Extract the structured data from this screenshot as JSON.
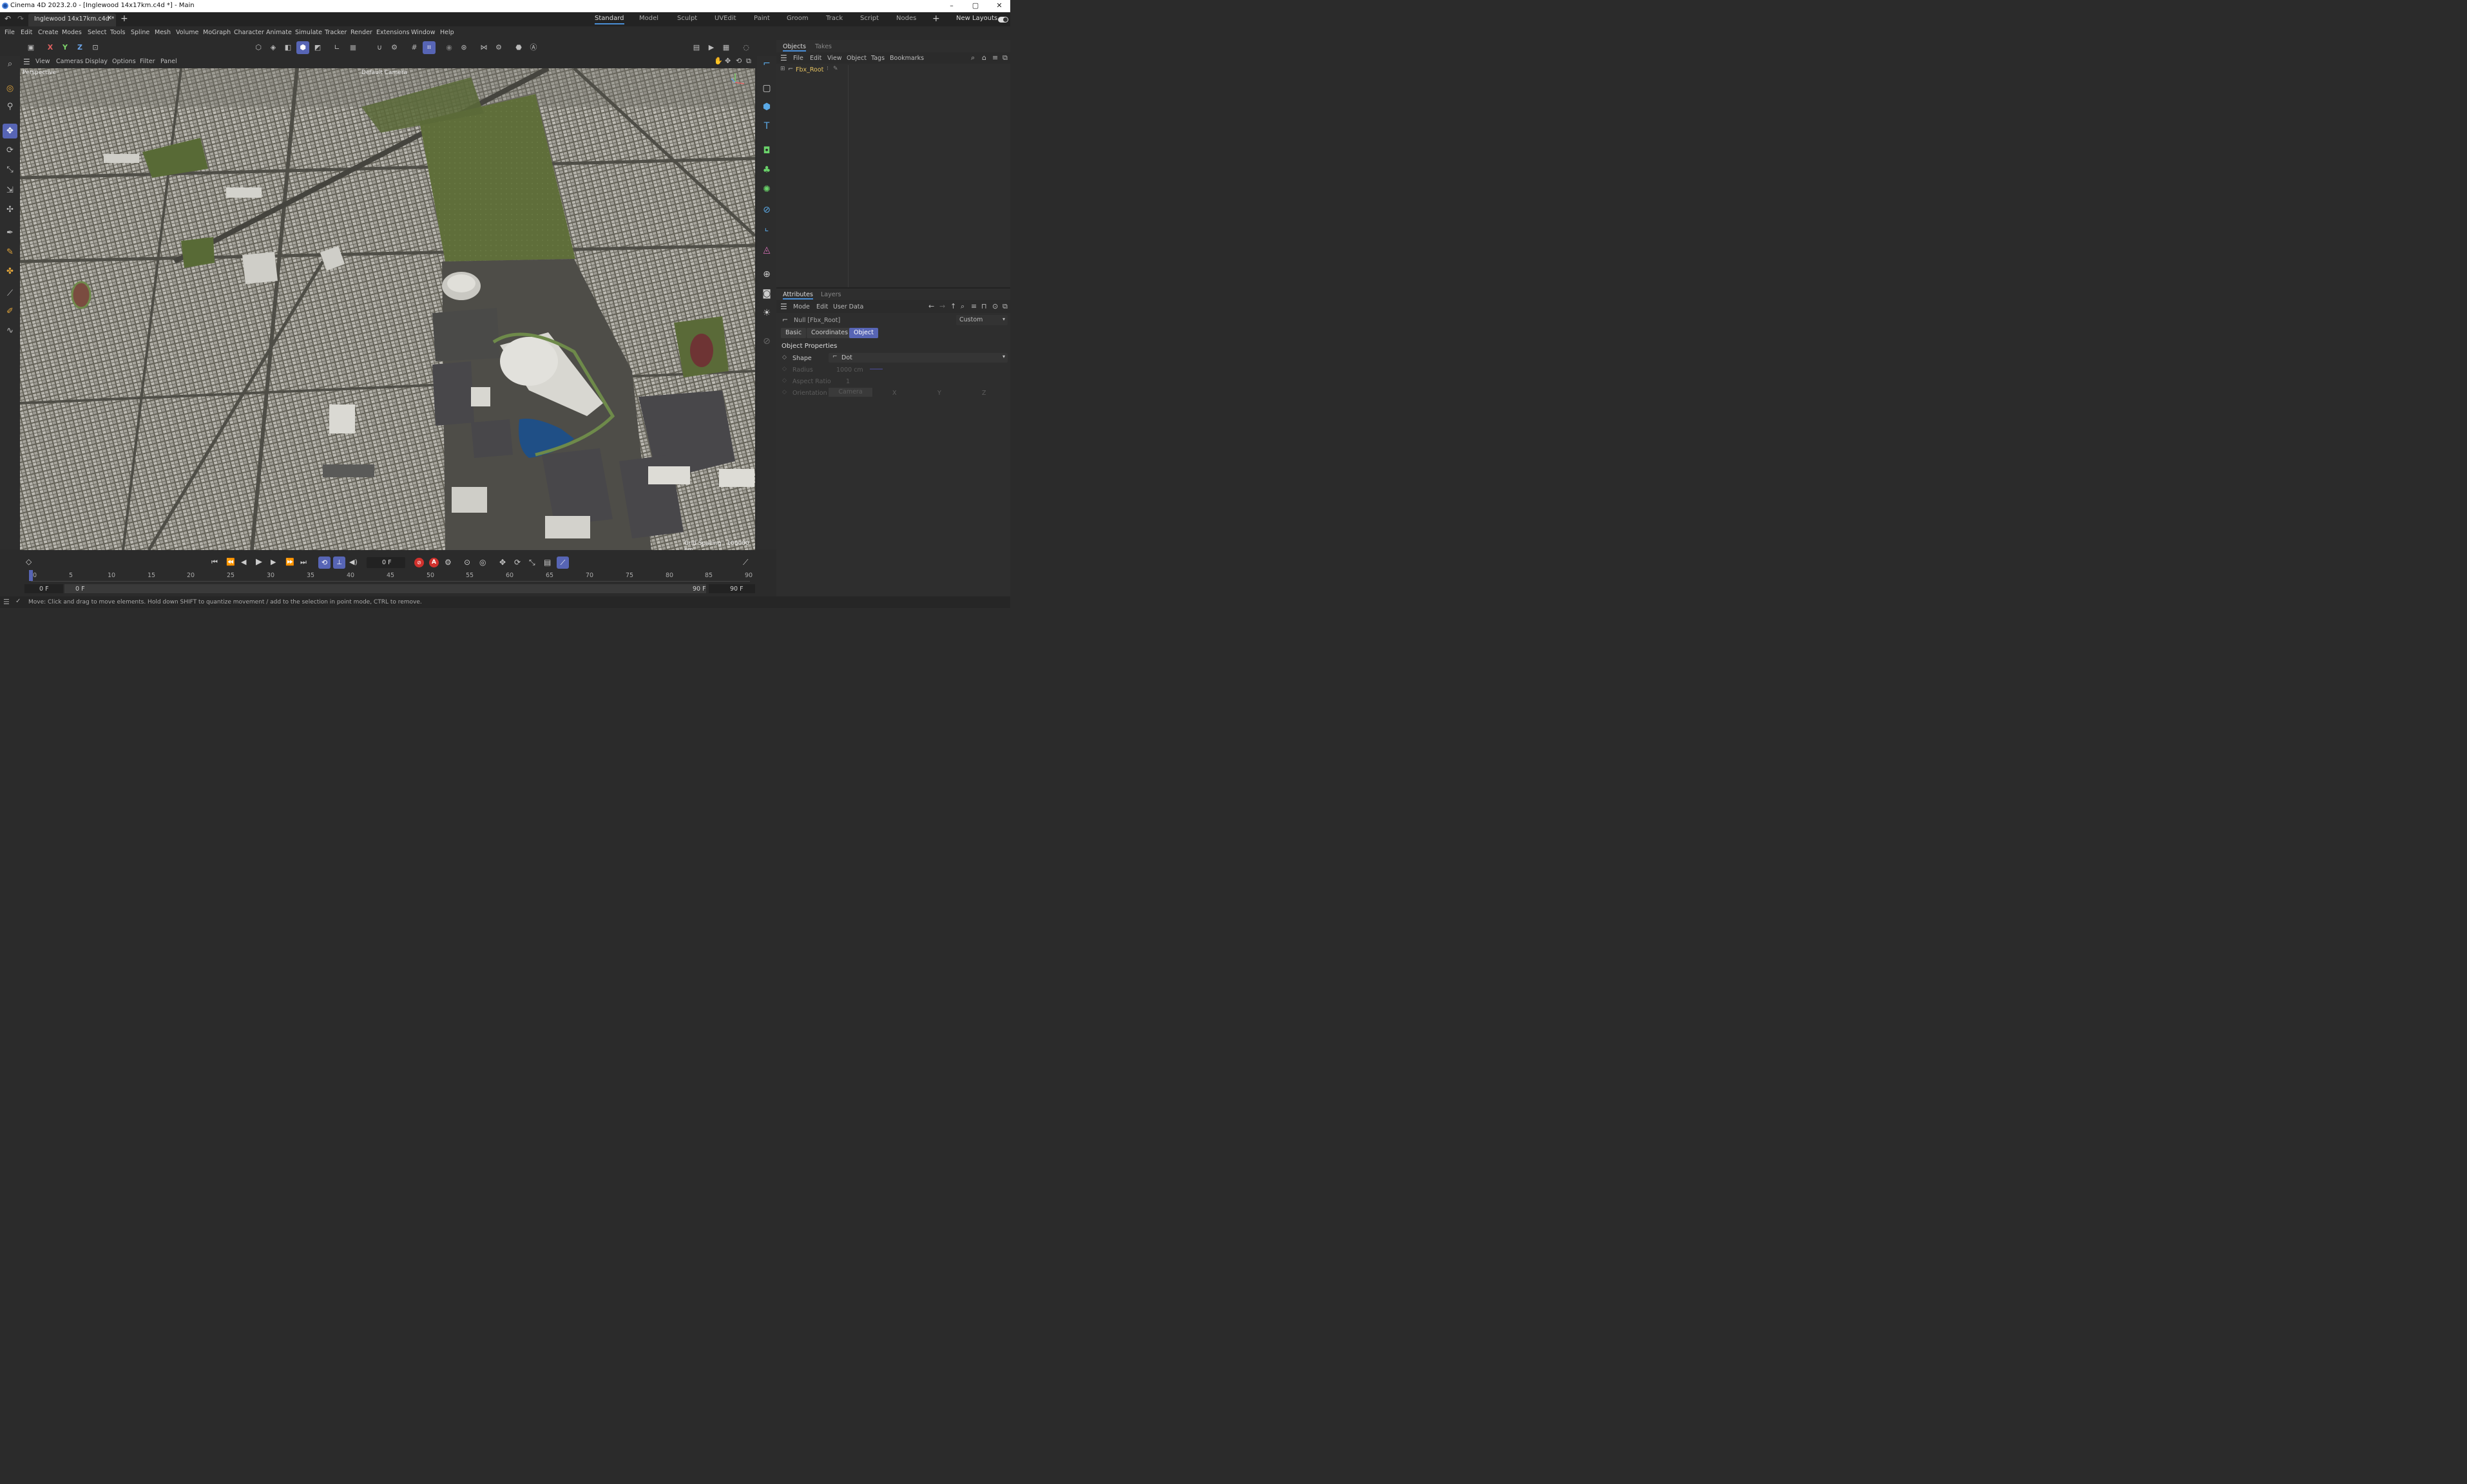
{
  "app": {
    "window_title": "Cinema 4D 2023.2.0 - [Inglewood 14x17km.c4d *] - Main",
    "doc_tab": "Inglewood 14x17km.c4d *",
    "layouts": [
      "Standard",
      "Model",
      "Sculpt",
      "UVEdit",
      "Paint",
      "Groom",
      "Track",
      "Script",
      "Nodes"
    ],
    "new_layouts": "New Layouts",
    "window_controls": {
      "minimize": "–",
      "maximize": "▢",
      "close": "✕"
    }
  },
  "menu": [
    "File",
    "Edit",
    "Create",
    "Modes",
    "Select",
    "Tools",
    "Spline",
    "Mesh",
    "Volume",
    "MoGraph",
    "Character",
    "Animate",
    "Simulate",
    "Tracker",
    "Render",
    "Extensions",
    "Window",
    "Help"
  ],
  "toolbar": {
    "axis_x": "X",
    "axis_y": "Y",
    "axis_z": "Z"
  },
  "viewport": {
    "menu": [
      "View",
      "Cameras",
      "Display",
      "Options",
      "Filter",
      "Panel"
    ],
    "projection_label": "Perspective",
    "camera_label": "Default Camera",
    "grid_spacing": "Grid Spacing : 100000 cm"
  },
  "objects_panel": {
    "tabs": [
      "Objects",
      "Takes"
    ],
    "menu": [
      "File",
      "Edit",
      "View",
      "Object",
      "Tags",
      "Bookmarks"
    ],
    "items": [
      {
        "name": "Fbx_Root"
      }
    ]
  },
  "attributes_panel": {
    "tabs": [
      "Attributes",
      "Layers"
    ],
    "menu": [
      "Mode",
      "Edit",
      "User Data"
    ],
    "header": "Null [Fbx_Root]",
    "preset": "Custom",
    "subtabs": [
      "Basic",
      "Coordinates",
      "Object"
    ],
    "section": "Object Properties",
    "props": {
      "shape_label": "Shape",
      "shape_value": "Dot",
      "radius_label": "Radius",
      "radius_value": "1000 cm",
      "aspect_label": "Aspect Ratio",
      "aspect_value": "1",
      "orientation_label": "Orientation",
      "orientation_value": "Camera",
      "axis_x": "X",
      "axis_y": "Y",
      "axis_z": "Z"
    }
  },
  "timeline": {
    "current_frame": "0 F",
    "ticks": [
      "0",
      "5",
      "10",
      "15",
      "20",
      "25",
      "30",
      "35",
      "40",
      "45",
      "50",
      "55",
      "60",
      "65",
      "70",
      "75",
      "80",
      "85",
      "90"
    ],
    "start_min": "0 F",
    "start": "0 F",
    "end": "90 F",
    "end_max": "90 F"
  },
  "status": "Move: Click and drag to move elements. Hold down SHIFT to quantize movement / add to the selection in point mode, CTRL to remove.",
  "colors": {
    "accent": "#5765b5",
    "layout_underline": "#4a8ed6",
    "object_name": "#e3c060",
    "park": "#5f6e3a",
    "water": "#1f4f86",
    "record": "#d0312d"
  }
}
